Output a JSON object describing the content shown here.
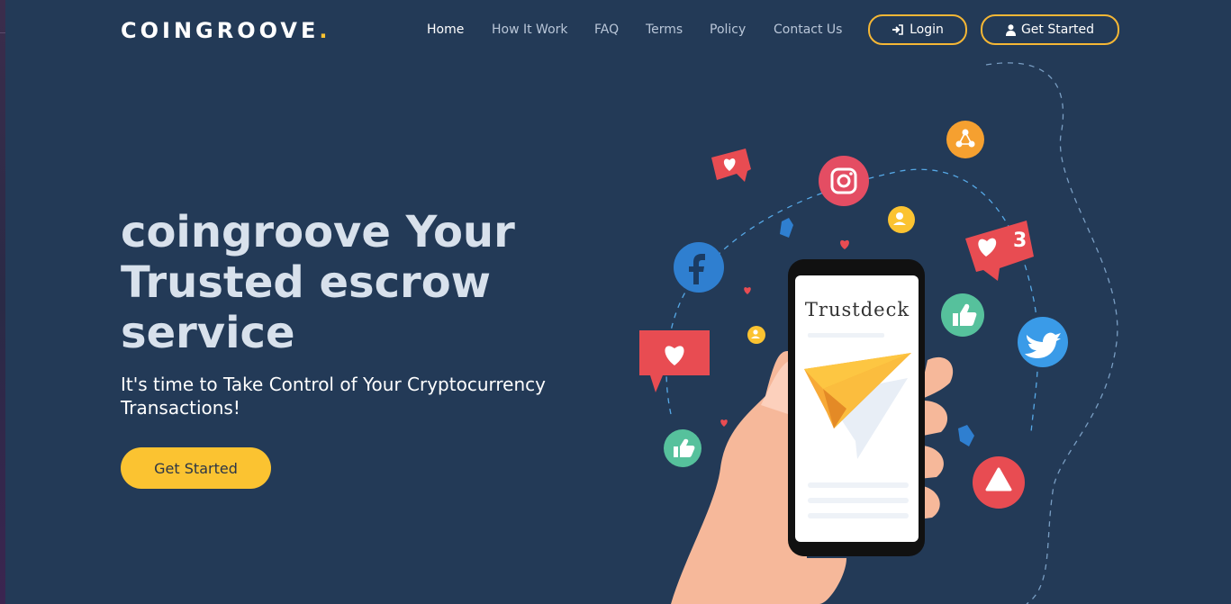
{
  "brand": {
    "name": "COINGROOVE",
    "dot": "."
  },
  "nav": [
    {
      "label": "Home",
      "active": true
    },
    {
      "label": "How It Work"
    },
    {
      "label": "FAQ"
    },
    {
      "label": "Terms"
    },
    {
      "label": "Policy"
    },
    {
      "label": "Contact Us"
    }
  ],
  "header_buttons": {
    "login": {
      "label": "Login",
      "icon": "sign-in-icon"
    },
    "get_started": {
      "label": "Get Started",
      "icon": "user-icon"
    }
  },
  "hero": {
    "title": "coingroove Your Trusted escrow service",
    "subtitle": "It's time to Take Control of Your Cryptocurrency Transactions!",
    "cta": "Get Started"
  },
  "illustration": {
    "phone_brand": "Trustdeck",
    "like_count": "3",
    "icons": [
      "facebook-icon",
      "instagram-icon",
      "twitter-icon",
      "share-icon",
      "user-badge-icon",
      "heart-bubble-icon",
      "thumbs-up-icon",
      "alert-triangle-icon",
      "paper-plane-icon",
      "hand-icon"
    ]
  },
  "colors": {
    "background": "#233a57",
    "accent": "#fbc331",
    "button_border": "#f5b735"
  }
}
